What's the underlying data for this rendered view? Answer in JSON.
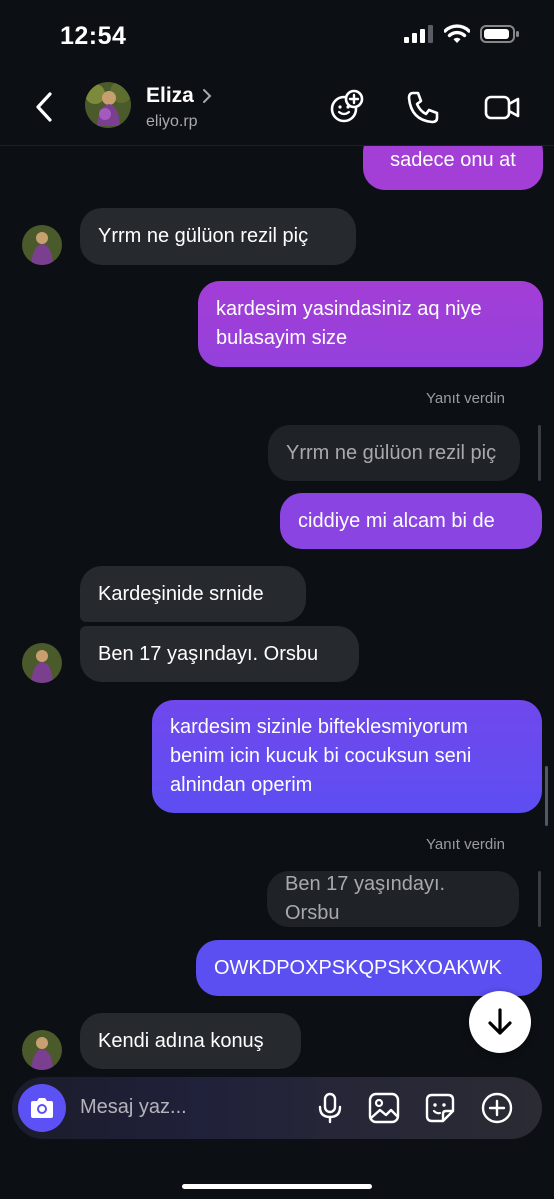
{
  "status": {
    "time": "12:54"
  },
  "header": {
    "name": "Eliza",
    "handle": "eliyo.rp"
  },
  "messages": [
    {
      "dir": "out",
      "text": "sadece onu at"
    },
    {
      "dir": "in",
      "text": "Yrrm ne gülüon rezil piç"
    },
    {
      "dir": "out",
      "text": "kardesim yasindasiniz aq niye bulasayim size"
    },
    {
      "dir": "meta",
      "text": "Yanıt verdin"
    },
    {
      "dir": "quote",
      "text": "Yrrm ne gülüon rezil piç"
    },
    {
      "dir": "out",
      "text": "ciddiye mi alcam bi de"
    },
    {
      "dir": "in",
      "text": "Kardeşinide srnide"
    },
    {
      "dir": "in",
      "text": "Ben 17 yaşındayı. Orsbu"
    },
    {
      "dir": "out",
      "text": "kardesim sizinle bifteklesmiyorum benim icin kucuk bi cocuksun seni alnindan operim"
    },
    {
      "dir": "meta",
      "text": "Yanıt verdin"
    },
    {
      "dir": "quote",
      "text": "Ben 17 yaşındayı. Orsbu"
    },
    {
      "dir": "out",
      "text": "OWKDPOXPSKQPSKXOAKWK"
    },
    {
      "dir": "in",
      "text": "Kendi adına konuş"
    }
  ],
  "composer": {
    "placeholder": "Mesaj yaz..."
  },
  "colors": {
    "accent": "#5b51f5",
    "bubble_top": "#a33ed6",
    "bubble_bottom": "#5b4ff2",
    "incoming": "#26292e"
  }
}
